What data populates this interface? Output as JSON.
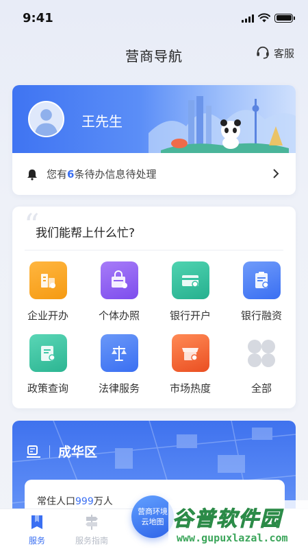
{
  "status_bar": {
    "time": "9:41"
  },
  "navbar": {
    "title": "营商导航",
    "service_label": "客服"
  },
  "user_card": {
    "name": "王先生",
    "notice": {
      "prefix": "您有",
      "count": "6",
      "suffix": "条待办信息待处理"
    }
  },
  "help": {
    "quote_mark": "“",
    "title": "我们能帮上什么忙?",
    "items": [
      {
        "label": "企业开办",
        "icon": "building-icon",
        "color": "#f5a524"
      },
      {
        "label": "个体办照",
        "icon": "shop-bag-icon",
        "color": "#8d5ef2"
      },
      {
        "label": "银行开户",
        "icon": "bank-card-icon",
        "color": "#35c2a0"
      },
      {
        "label": "银行融资",
        "icon": "finance-doc-icon",
        "color": "#4f84f5"
      },
      {
        "label": "政策查询",
        "icon": "policy-doc-icon",
        "color": "#3ec6a6"
      },
      {
        "label": "法律服务",
        "icon": "scales-icon",
        "color": "#4a7ff3"
      },
      {
        "label": "市场热度",
        "icon": "market-stall-icon",
        "color": "#f26a3c"
      },
      {
        "label": "全部",
        "icon": "four-petal-icon",
        "color": "#d6d9e0"
      }
    ]
  },
  "district": {
    "name": "成华区",
    "population_prefix": "常住人口",
    "population_value": "999",
    "population_unit": "万人"
  },
  "tabbar": {
    "tabs": [
      {
        "label": "服务"
      },
      {
        "label": "服务指南"
      }
    ],
    "fab_line1": "营商环境",
    "fab_line2": "云地图"
  },
  "watermark": {
    "main": "谷普软件园",
    "sub": "www.gupuxlazal.com"
  }
}
